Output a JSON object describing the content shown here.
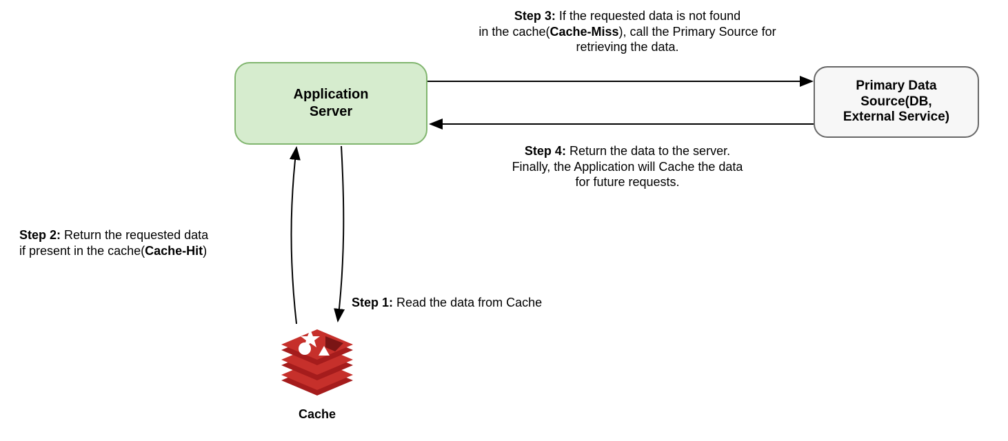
{
  "nodes": {
    "app_server": "Application\nServer",
    "data_source": "Primary Data\nSource(DB,\nExternal Service)",
    "cache_label": "Cache"
  },
  "steps": {
    "s1": {
      "bold": "Step 1:",
      "text": " Read the data from Cache"
    },
    "s2_line1": {
      "bold": "Step 2:",
      "text": " Return the requested data"
    },
    "s2_line2a": "if present in the cache(",
    "s2_line2_bold": "Cache-Hit",
    "s2_line2b": ")",
    "s3_line1": {
      "bold": "Step 3:",
      "text": " If the requested data is not found"
    },
    "s3_line2a": "in the cache(",
    "s3_line2_bold": "Cache-Miss",
    "s3_line2b": "), call the Primary Source for",
    "s3_line3": "retrieving the data.",
    "s4_line1": {
      "bold": "Step 4:",
      "text": " Return the data to the server."
    },
    "s4_line2": "Finally, the Application will Cache the data",
    "s4_line3": "for future requests."
  }
}
